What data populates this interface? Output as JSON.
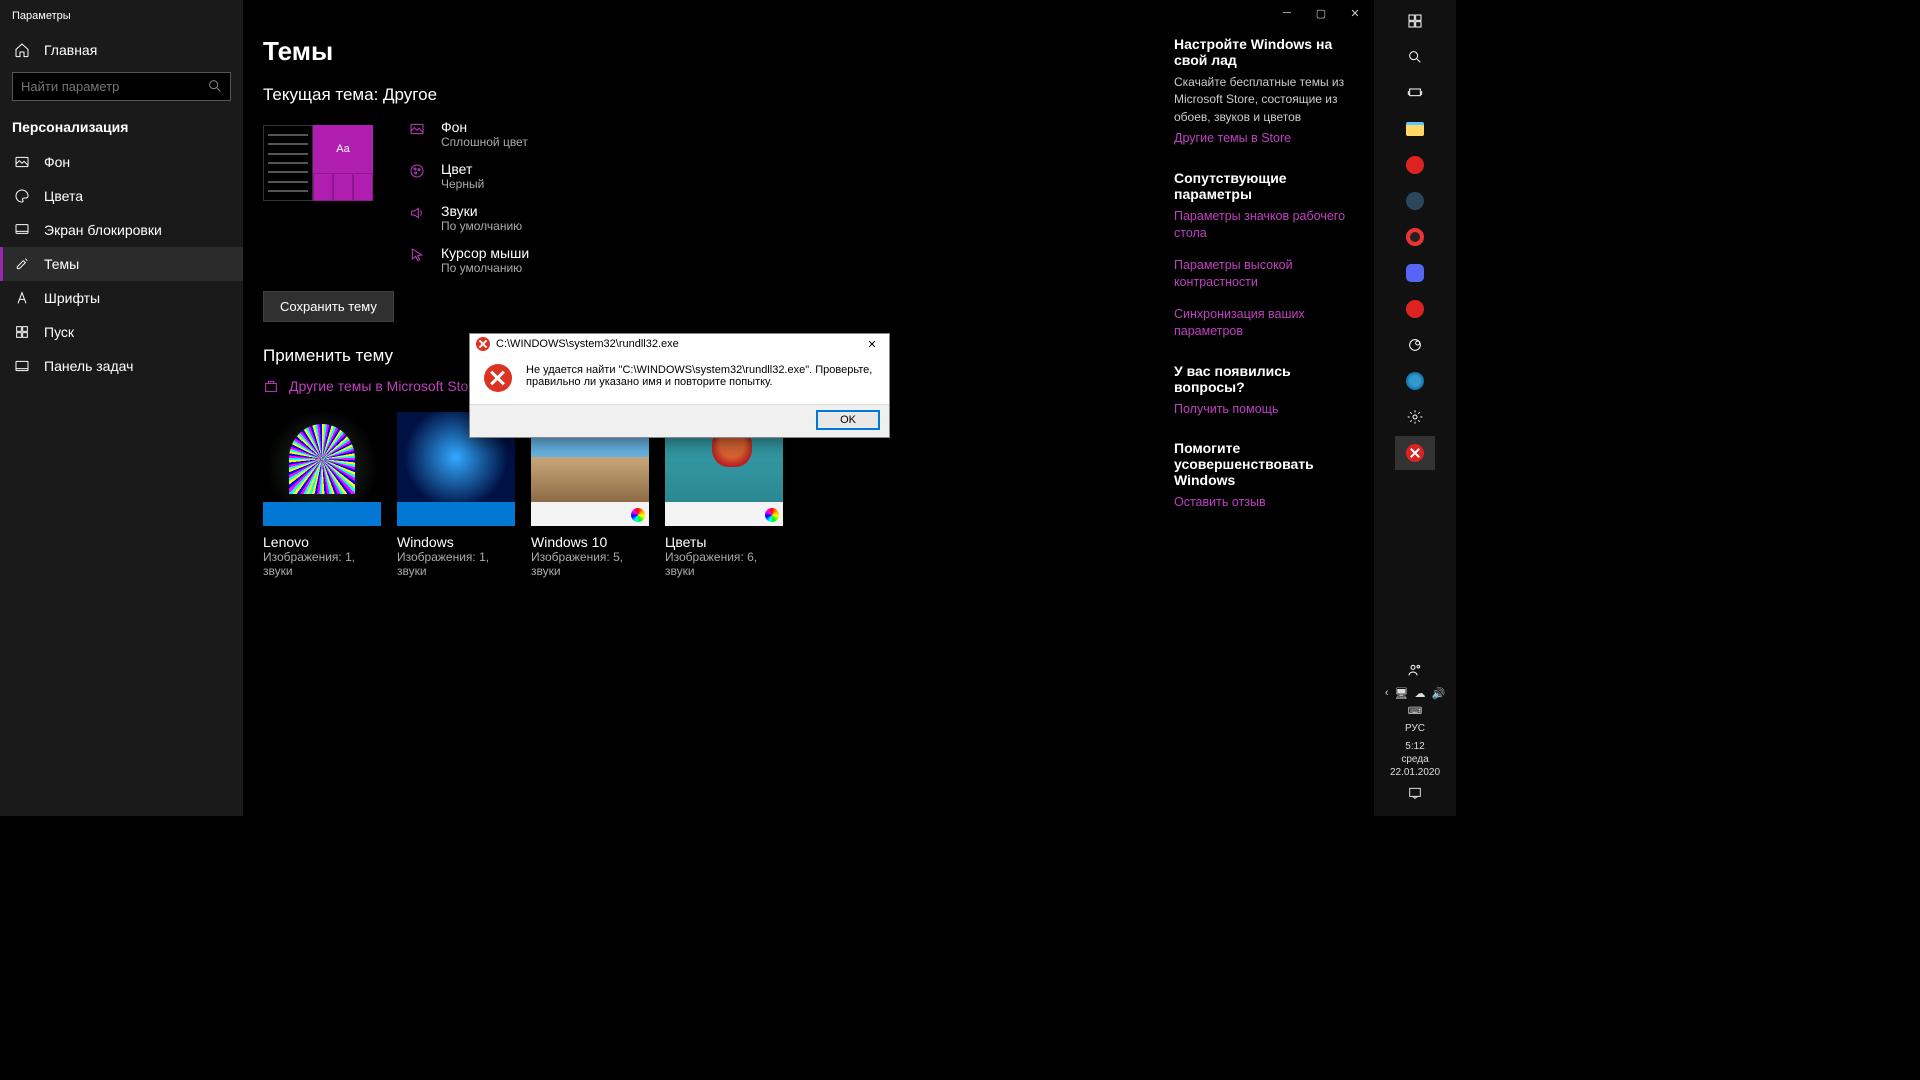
{
  "window": {
    "title": "Параметры"
  },
  "sidebar": {
    "home": "Главная",
    "search_placeholder": "Найти параметр",
    "section": "Персонализация",
    "items": [
      {
        "label": "Фон"
      },
      {
        "label": "Цвета"
      },
      {
        "label": "Экран блокировки"
      },
      {
        "label": "Темы"
      },
      {
        "label": "Шрифты"
      },
      {
        "label": "Пуск"
      },
      {
        "label": "Панель задач"
      }
    ],
    "active_index": 3
  },
  "main": {
    "heading": "Темы",
    "current_label": "Текущая тема: Другое",
    "preview_sample": "Aa",
    "props": [
      {
        "name": "Фон",
        "value": "Сплошной цвет"
      },
      {
        "name": "Цвет",
        "value": "Черный"
      },
      {
        "name": "Звуки",
        "value": "По умолчанию"
      },
      {
        "name": "Курсор мыши",
        "value": "По умолчанию"
      }
    ],
    "save_btn": "Сохранить тему",
    "apply_heading": "Применить тему",
    "store_link": "Другие темы в Microsoft Store",
    "themes": [
      {
        "name": "Lenovo",
        "meta": "Изображения: 1, звуки",
        "variant": "t-lenovo"
      },
      {
        "name": "Windows",
        "meta": "Изображения: 1, звуки",
        "variant": "t-win"
      },
      {
        "name": "Windows 10",
        "meta": "Изображения: 5, звуки",
        "variant": "t-win10",
        "color_marker": true
      },
      {
        "name": "Цветы",
        "meta": "Изображения: 6, звуки",
        "variant": "t-flowers",
        "color_marker": true
      }
    ]
  },
  "aside": {
    "customize_heading": "Настройте Windows на свой лад",
    "customize_text": "Скачайте бесплатные темы из Microsoft Store, состоящие из обоев, звуков и цветов",
    "customize_link": "Другие темы в Store",
    "related_heading": "Сопутствующие параметры",
    "related_links": [
      "Параметры значков рабочего стола",
      "Параметры высокой контрастности",
      "Синхронизация ваших параметров"
    ],
    "questions_heading": "У вас появились вопросы?",
    "help_link": "Получить помощь",
    "improve_heading": "Помогите усовершенствовать Windows",
    "feedback_link": "Оставить отзыв"
  },
  "dialog": {
    "title": "C:\\WINDOWS\\system32\\rundll32.exe",
    "message": "Не удается найти \"C:\\WINDOWS\\system32\\rundll32.exe\". Проверьте, правильно ли указано имя и повторите попытку.",
    "ok": "OK"
  },
  "taskbar": {
    "lang": "РУС",
    "time": "5:12",
    "day": "среда",
    "date": "22.01.2020"
  }
}
